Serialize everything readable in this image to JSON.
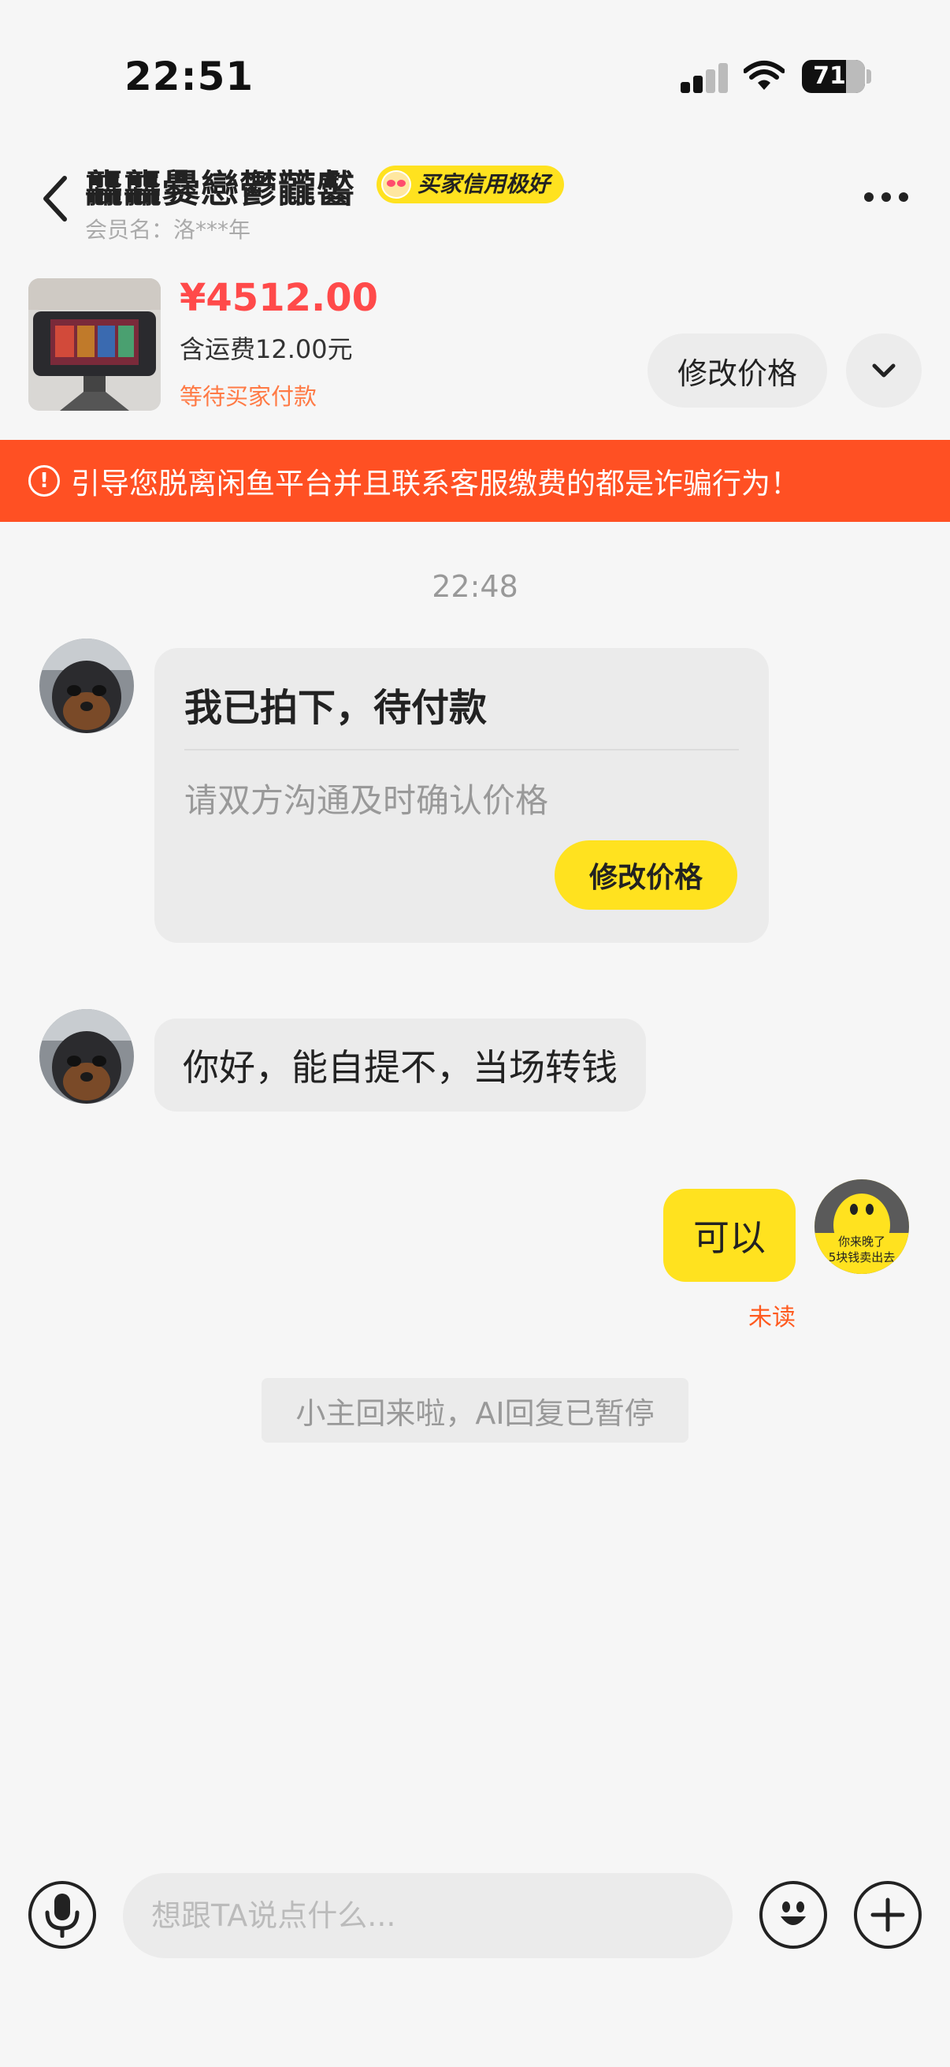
{
  "status_bar": {
    "time": "22:51",
    "battery": "71"
  },
  "header": {
    "title": "龘龘爨戀鬱龖齾",
    "credit_badge": "买家信用极好",
    "member_name": "会员名：洛***年"
  },
  "product": {
    "price": "¥4512.00",
    "shipping": "含运费12.00元",
    "status": "等待买家付款",
    "edit_price_label": "修改价格"
  },
  "warning": {
    "text": "引导您脱离闲鱼平台并且联系客服缴费的都是诈骗行为！"
  },
  "chat": {
    "timestamp": "22:48",
    "order_card": {
      "title": "我已拍下，待付款",
      "desc": "请双方沟通及时确认价格",
      "button_label": "修改价格"
    },
    "incoming_message": "你好，能自提不，当场转钱",
    "outgoing_message": "可以",
    "outgoing_status": "未读",
    "my_avatar_text": [
      "你来晚了",
      "5块钱卖出去"
    ],
    "system_note": "小主回来啦，AI回复已暂停"
  },
  "input_bar": {
    "placeholder": "想跟TA说点什么..."
  },
  "colors": {
    "accent_yellow": "#ffe21f",
    "warning_orange": "#ff5023",
    "price_red": "#ff4a4a"
  }
}
